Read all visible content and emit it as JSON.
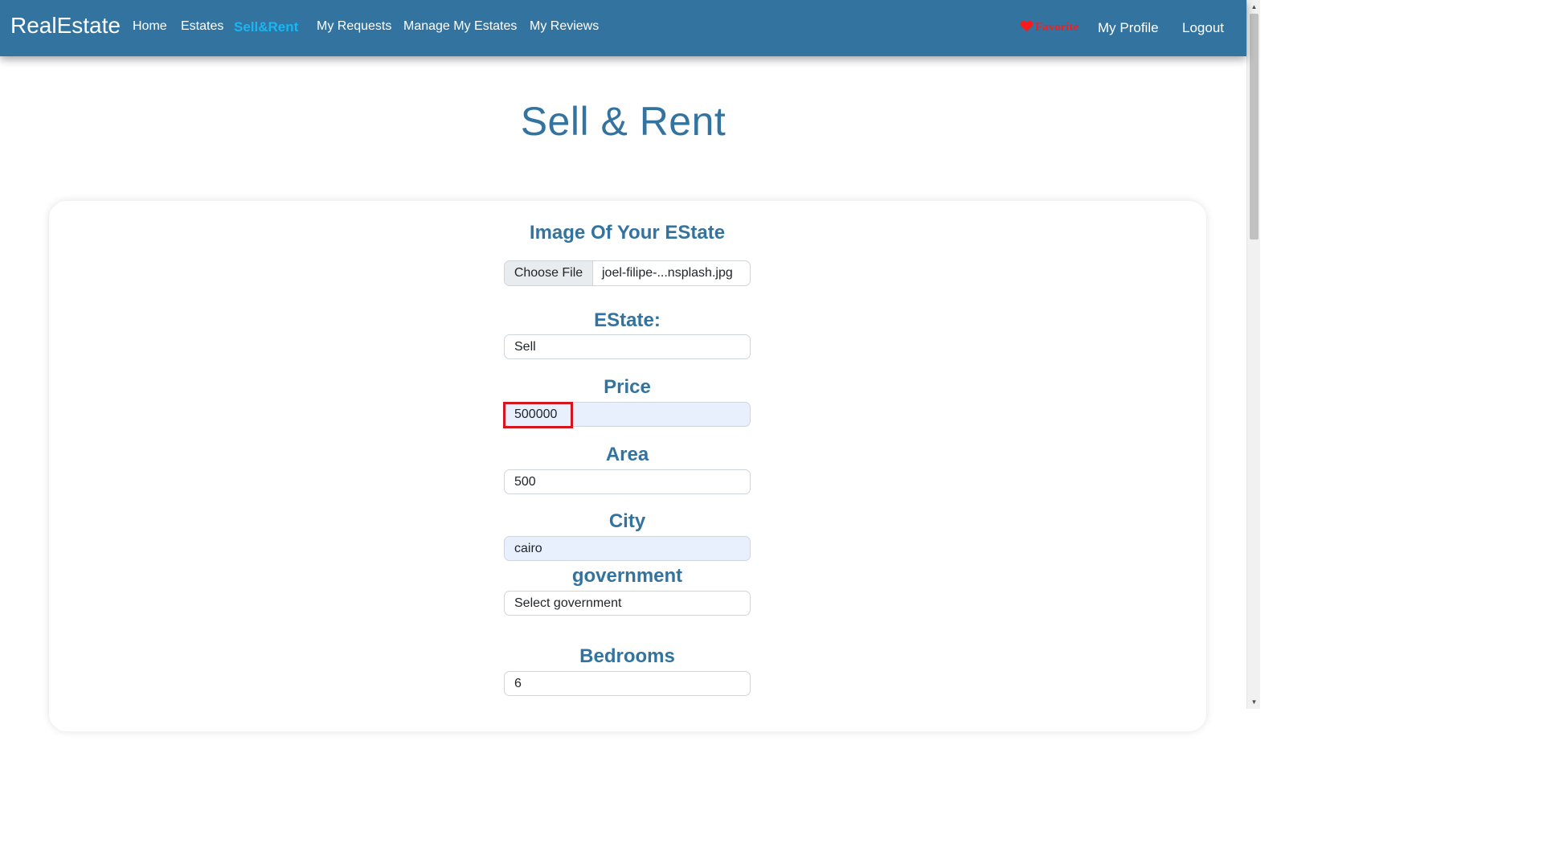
{
  "navbar": {
    "brand": "RealEstate",
    "links": [
      "Home",
      "Estates",
      "Sell&Rent",
      "My Requests",
      "Manage My Estates",
      "My Reviews"
    ],
    "favorite": "Favorite",
    "profile": "My Profile",
    "logout": "Logout",
    "colors": {
      "bar": "#33739f",
      "active": "#19b6f2",
      "favorite": "#ff1a1a"
    }
  },
  "page": {
    "title": "Sell & Rent"
  },
  "form": {
    "image_label": "Image Of Your EState",
    "file_button": "Choose File",
    "file_name": "joel-filipe-...nsplash.jpg",
    "estate_label": "EState:",
    "estate_value": "Sell",
    "price_label": "Price",
    "price_value": "500000",
    "area_label": "Area",
    "area_value": "500",
    "city_label": "City",
    "city_value": "cairo",
    "government_label": "government",
    "government_value": "Select government",
    "bedrooms_label": "Bedrooms",
    "bedrooms_value": "6"
  }
}
